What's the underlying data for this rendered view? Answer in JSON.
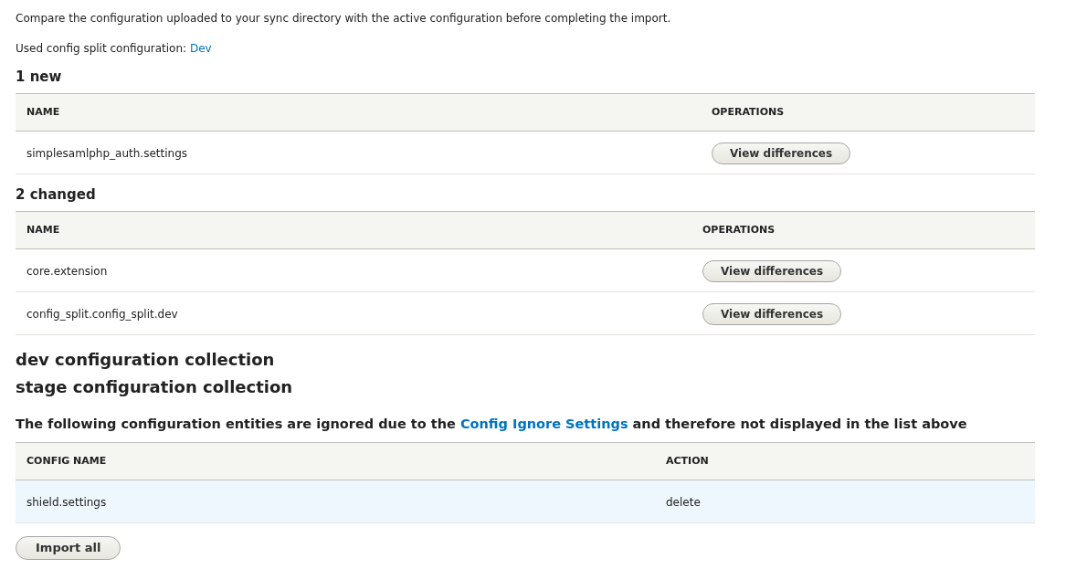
{
  "intro": "Compare the configuration uploaded to your sync directory with the active configuration before completing the import.",
  "split": {
    "label": "Used config split configuration:",
    "link": "Dev"
  },
  "sections": [
    {
      "kind": "table",
      "heading": "1 new",
      "columns": [
        "NAME",
        "OPERATIONS"
      ],
      "rows": [
        {
          "name": "simplesamlphp_auth.settings",
          "button": "View differences",
          "highlighted": false
        }
      ]
    },
    {
      "kind": "table",
      "heading": "2 changed",
      "columns": [
        "NAME",
        "OPERATIONS"
      ],
      "rows": [
        {
          "name": "core.extension",
          "button": "View differences",
          "highlighted": false
        },
        {
          "name": "config_split.config_split.dev",
          "button": "View differences",
          "highlighted": false
        }
      ]
    },
    {
      "kind": "collection",
      "heading": "dev configuration collection"
    },
    {
      "kind": "collection",
      "heading": "stage configuration collection"
    }
  ],
  "ignored": {
    "heading_before": "The following configuration entities are ignored due to the",
    "heading_link": "Config Ignore Settings",
    "heading_after": "and therefore not displayed in the list above",
    "columns": [
      "CONFIG NAME",
      "ACTION"
    ],
    "rows": [
      {
        "name": "shield.settings",
        "action": "delete",
        "highlighted": true
      }
    ]
  },
  "import_button": "Import all"
}
